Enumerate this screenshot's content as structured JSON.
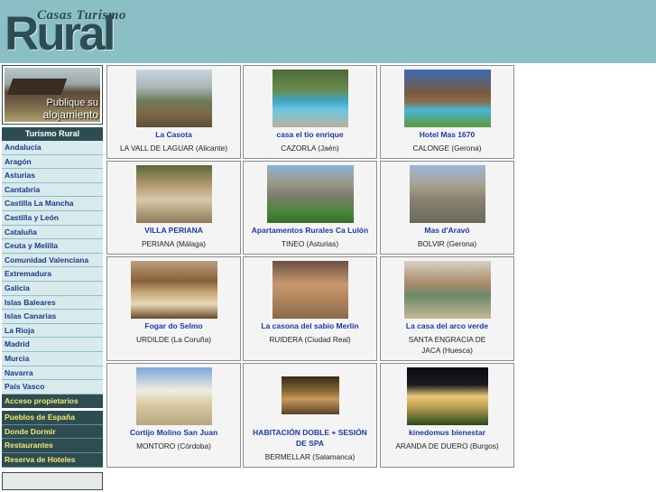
{
  "header": {
    "logo_small": "Casas Turismo",
    "logo_big": "Rural"
  },
  "promo": {
    "line1": "Publique su",
    "line2": "alojamiento"
  },
  "sidebar": {
    "heading": "Turismo Rural",
    "regions": [
      "Andalucía",
      "Aragón",
      "Asturias",
      "Cantabria",
      "Castilla La Mancha",
      "Castilla y León",
      "Cataluña",
      "Ceuta y Melilla",
      "Comunidad Valenciana",
      "Extremadura",
      "Galicia",
      "Islas Baleares",
      "Islas Canarias",
      "La Rioja",
      "Madrid",
      "Murcia",
      "Navarra",
      "País Vasco"
    ],
    "owners": "Acceso propietarios",
    "extras": [
      "Pueblos de España",
      "Donde Dormir",
      "Restaurantes",
      "Reserva de Hoteles"
    ]
  },
  "listings": [
    {
      "title": "La Casota",
      "location": "LA VALL DE LAGUAR (Alicante)",
      "photo": "mountain-valley-photo"
    },
    {
      "title": "casa el tio enrique",
      "location": "CAZORLA (Jaén)",
      "photo": "pool-photo"
    },
    {
      "title": "Hotel Mas 1670",
      "location": "CALONGE (Gerona)",
      "photo": "hotel-pool-photo"
    },
    {
      "title": "VILLA PERIANA",
      "location": "PERIANA (Málaga)",
      "photo": "villa-photo"
    },
    {
      "title": "Apartamentos Rurales Ca Lulón",
      "location": "TINEO (Asturias)",
      "photo": "stone-house-photo"
    },
    {
      "title": "Mas d'Aravó",
      "location": "BOLVIR (Gerona)",
      "photo": "farmhouse-photo"
    },
    {
      "title": "Fogar do Selmo",
      "location": "URDILDE (La Coruña)",
      "photo": "bedroom-photo"
    },
    {
      "title": "La casona del sabio Merlín",
      "location": "RUIDERA (Ciudad Real)",
      "photo": "courtyard-photo"
    },
    {
      "title": "La casa del arco verde",
      "location": "SANTA ENGRACIA DE JACA (Huesca)",
      "photo": "interior-photo"
    },
    {
      "title": "Cortijo Molino San Juan",
      "location": "MONTORO (Córdoba)",
      "photo": "white-house-photo"
    },
    {
      "title": "HABITACIÓN DOBLE + SESIÓN DE SPA",
      "location": "BERMELLAR (Salamanca)",
      "photo": "spa-photo"
    },
    {
      "title": "kinedomus bienestar",
      "location": "ARANDA DE DUERO (Burgos)",
      "photo": "night-house-photo"
    }
  ]
}
